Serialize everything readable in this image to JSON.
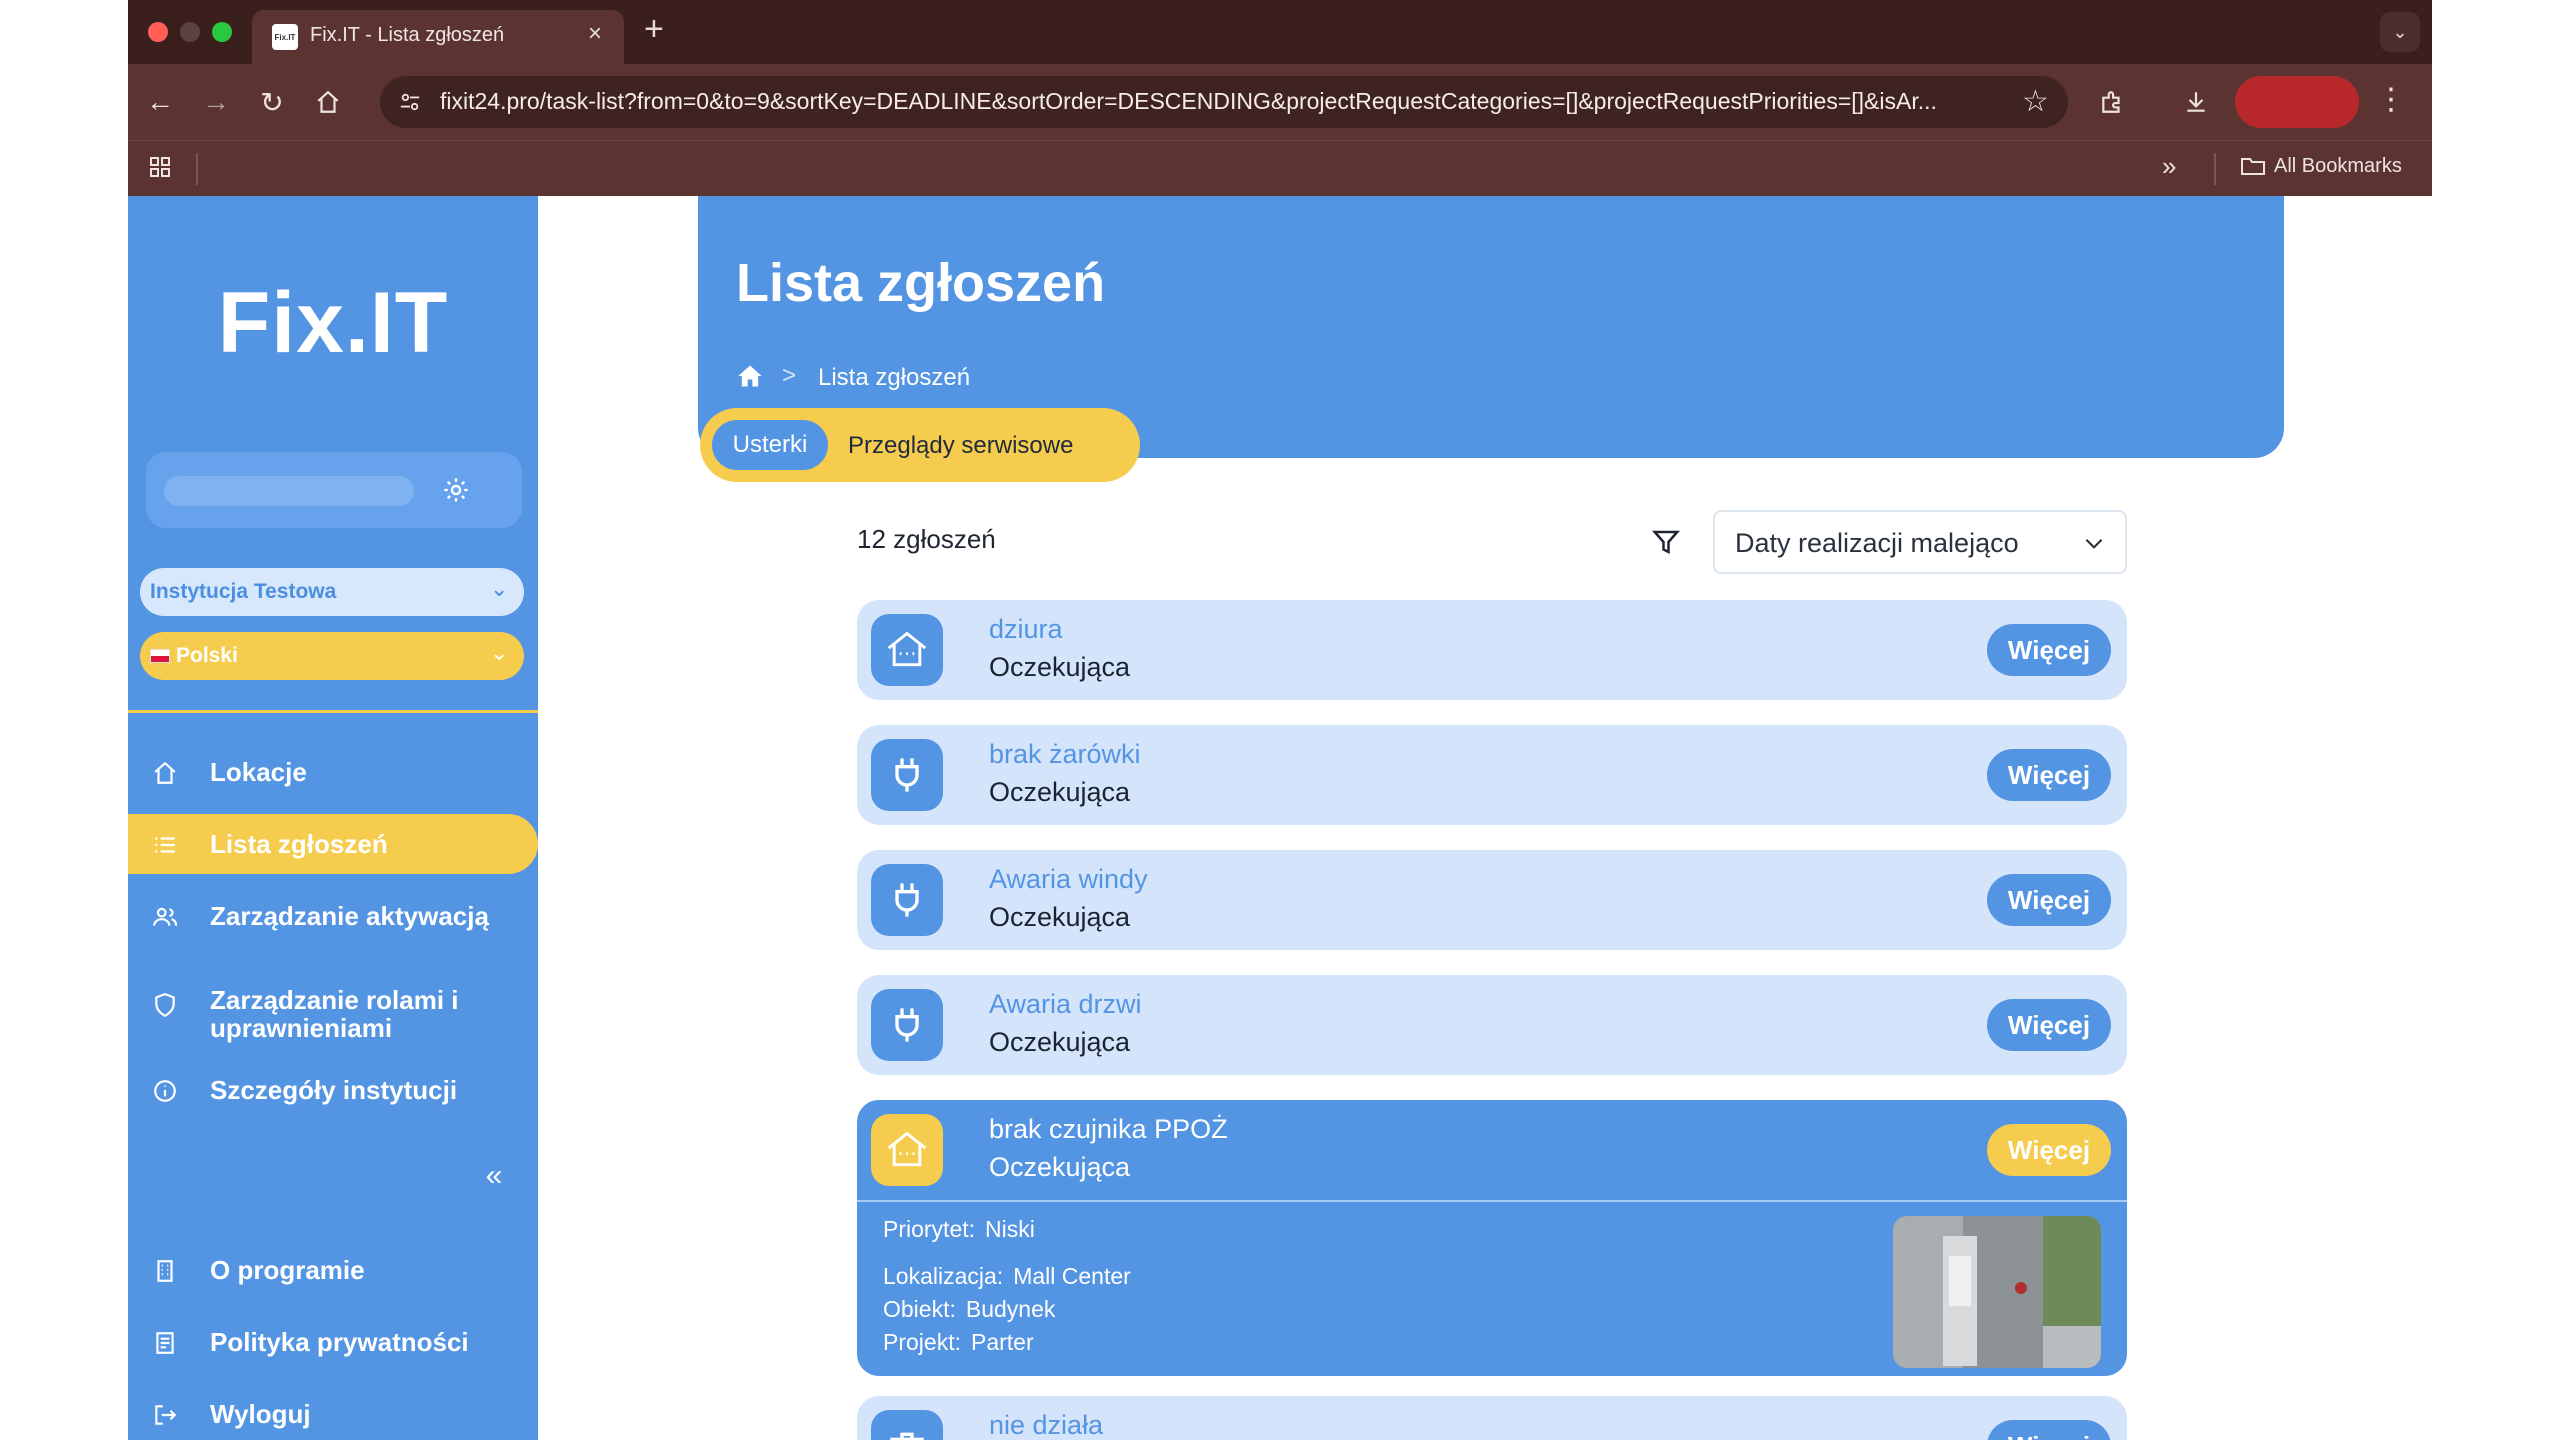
{
  "browser": {
    "tab_title": "Fix.IT - Lista zgłoszeń",
    "tab_favicon_text": "Fix.IT",
    "url": "fixit24.pro/task-list?from=0&to=9&sortKey=DEADLINE&sortOrder=DESCENDING&projectRequestCategories=[]&projectRequestPriorities=[]&isAr...",
    "all_bookmarks": "All Bookmarks",
    "overflow": "»"
  },
  "sidebar": {
    "logo": "Fix.IT",
    "institution_select": "Instytucja Testowa",
    "language_select": "Polski",
    "nav": [
      {
        "label": "Lokacje",
        "icon": "home-icon"
      },
      {
        "label": "Lista zgłoszeń",
        "icon": "list-icon",
        "active": true
      },
      {
        "label": "Zarządzanie aktywacją",
        "icon": "users-icon"
      },
      {
        "label": "Zarządzanie rolami i uprawnieniami",
        "icon": "shield-icon"
      },
      {
        "label": "Szczegóły instytucji",
        "icon": "info-icon"
      }
    ],
    "collapse": "«",
    "bottom_nav": [
      {
        "label": "O programie",
        "icon": "building-icon"
      },
      {
        "label": "Polityka prywatności",
        "icon": "document-icon"
      },
      {
        "label": "Wyloguj",
        "icon": "logout-icon"
      }
    ]
  },
  "header": {
    "title": "Lista zgłoszeń",
    "breadcrumb_sep": ">",
    "breadcrumb_current": "Lista zgłoszeń",
    "tabs": {
      "active": "Usterki",
      "other": "Przeglądy serwisowe"
    }
  },
  "list": {
    "count": "12 zgłoszeń",
    "sort_value": "Daty realizacji malejąco",
    "more_label": "Więcej",
    "items": [
      {
        "name": "dziura",
        "status": "Oczekująca",
        "icon": "house-icon"
      },
      {
        "name": "brak żarówki",
        "status": "Oczekująca",
        "icon": "plug-icon"
      },
      {
        "name": "Awaria windy",
        "status": "Oczekująca",
        "icon": "plug-icon"
      },
      {
        "name": "Awaria drzwi",
        "status": "Oczekująca",
        "icon": "plug-icon"
      }
    ],
    "expanded": {
      "name": "brak czujnika PPOŻ",
      "status": "Oczekująca",
      "icon": "house-icon",
      "details": {
        "priority_label": "Priorytet:",
        "priority_value": "Niski",
        "location_label": "Lokalizacja:",
        "location_value": "Mall Center",
        "object_label": "Obiekt:",
        "object_value": "Budynek",
        "project_label": "Projekt:",
        "project_value": "Parter"
      }
    },
    "partial_item": {
      "name": "nie działa",
      "more_label": "Więcej"
    }
  },
  "colors": {
    "primary": "#5394e3",
    "accent": "#f6cc4f",
    "item_bg": "#d4e5fb"
  }
}
